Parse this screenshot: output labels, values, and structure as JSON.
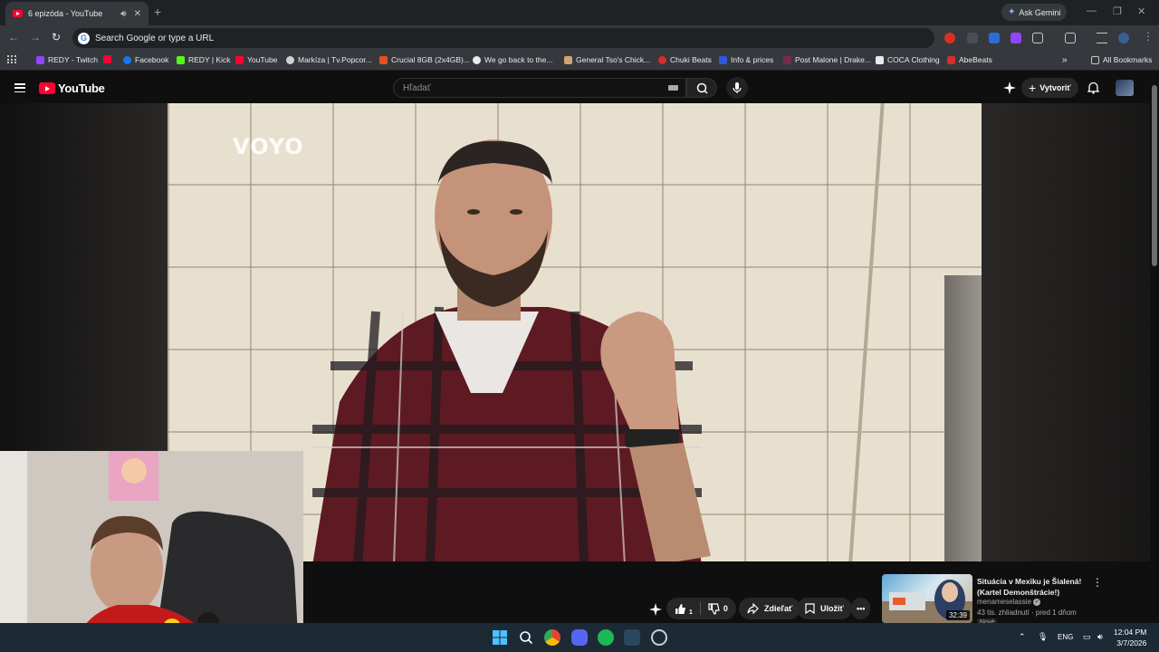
{
  "browser": {
    "tab_title": "6 epizóda - YouTube",
    "new_tab_symbol": "+",
    "ask_gemini": "Ask Gemini",
    "omnibox_placeholder": "Search Google or type a URL",
    "bookmarks": [
      {
        "label": "REDY - Twitch",
        "color": "#9146ff"
      },
      {
        "label": "",
        "color": "#ff0033"
      },
      {
        "label": "Facebook",
        "color": "#1877f2"
      },
      {
        "label": "REDY | Kick",
        "color": "#53fc18"
      },
      {
        "label": "YouTube",
        "color": "#ff0033"
      },
      {
        "label": "Markíza | Tv.Popcor...",
        "color": "#d0d0d0"
      },
      {
        "label": "Crucial 8GB (2x4GB)...",
        "color": "#e8501e"
      },
      {
        "label": "We go back to the...",
        "color": "#e8eaed"
      },
      {
        "label": "General Tso's Chick...",
        "color": "#d4a373"
      },
      {
        "label": "Chuki Beats",
        "color": "#d92c2c"
      },
      {
        "label": "Info & prices",
        "color": "#2c59d9"
      },
      {
        "label": "Post Malone | Drake...",
        "color": "#7a2b4f"
      },
      {
        "label": "COCA Clothing",
        "color": "#e8eaed"
      },
      {
        "label": "AbeBeats",
        "color": "#d92c2c"
      }
    ],
    "all_bookmarks": "All Bookmarks"
  },
  "youtube": {
    "logo_text": "YouTube",
    "search_placeholder": "Hľadať",
    "create_label": "Vytvoriť",
    "video_watermark": "VOYO",
    "like_count": "1",
    "dislike_count": "0",
    "share_label": "Zdieľať",
    "save_label": "Uložiť",
    "recommended": {
      "title": "Situácia v Mexiku je Šialená! (Kartel Demonštrácie!)",
      "channel": "menameselassie",
      "views": "43 tis. zhliadnutí",
      "age": "pred 1 dňom",
      "duration": "32:39",
      "badge": "Nové"
    }
  },
  "taskbar": {
    "language": "ENG",
    "time": "12:04 PM",
    "date": "3/7/2026"
  },
  "colors": {
    "accent": "#ff0033",
    "chrome_bg": "#35393d",
    "taskbar_bg": "#1c2a36"
  }
}
